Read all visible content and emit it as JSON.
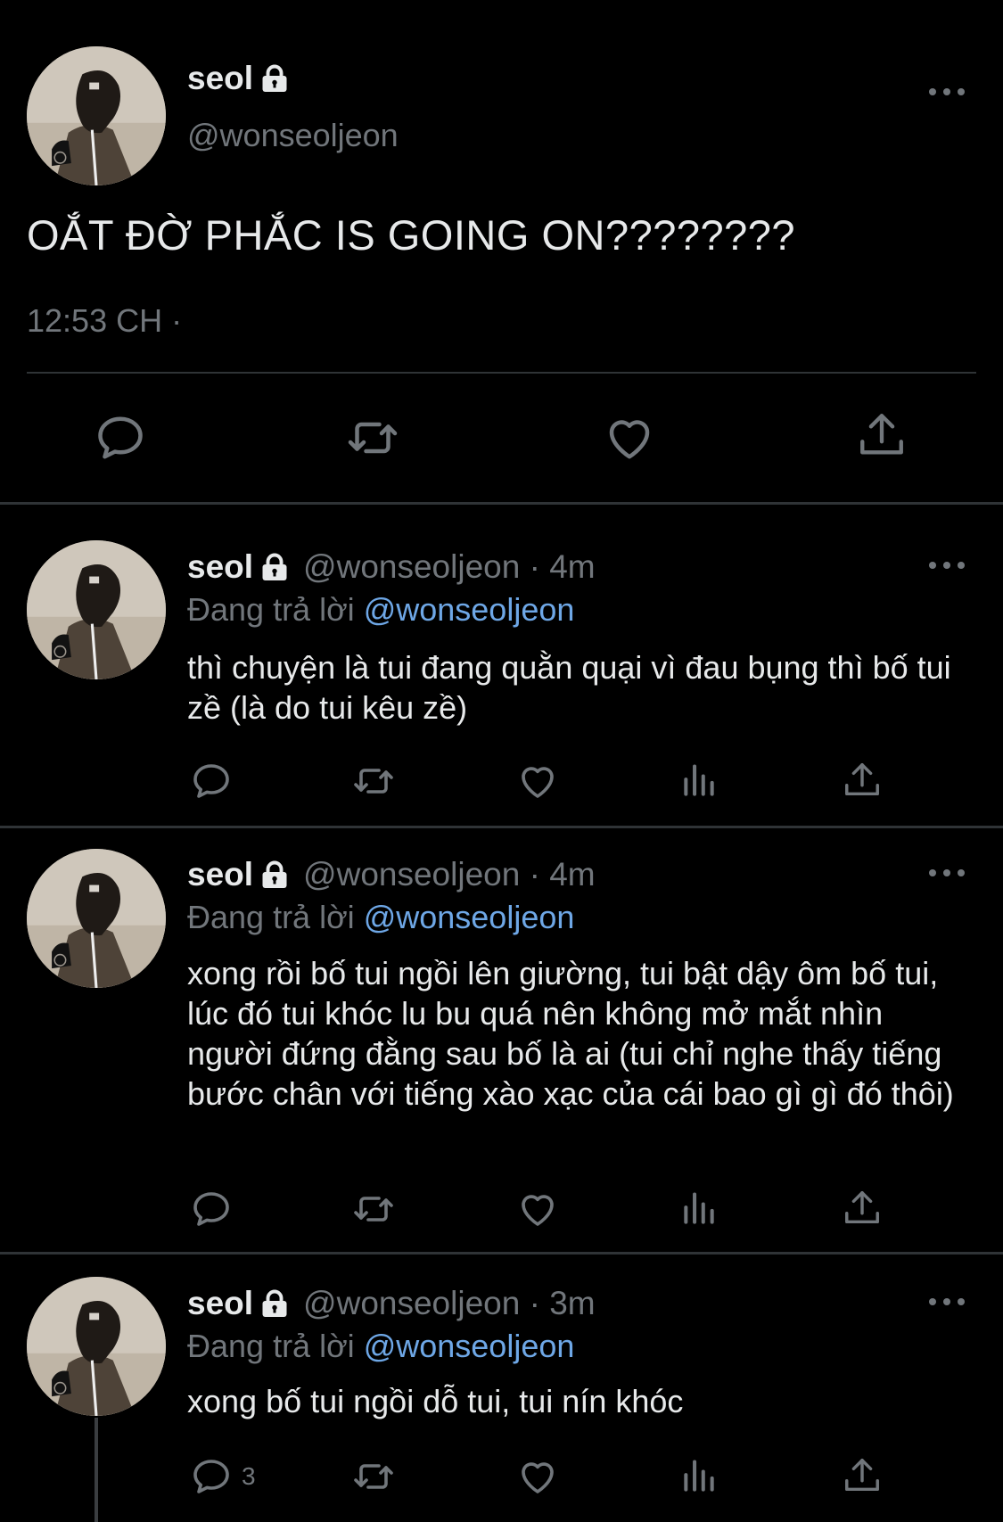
{
  "main": {
    "name": "seol",
    "handle": "@wonseoljeon",
    "text": "OẮT ĐỜ PHẮC IS GOING ON????????",
    "time": "12:53 CH ·"
  },
  "replies": [
    {
      "name": "seol",
      "handle": "@wonseoljeon · 4m",
      "replying_label": "Đang trả lời",
      "replying_to": "@wonseoljeon",
      "text": "thì chuyện là tui đang quằn quại vì đau bụng thì bố tui zề (là do tui kêu zề)"
    },
    {
      "name": "seol",
      "handle": "@wonseoljeon · 4m",
      "replying_label": "Đang trả lời",
      "replying_to": "@wonseoljeon",
      "text": "xong rồi bố tui ngồi lên giường, tui bật dậy ôm bố tui, lúc đó tui khóc lu bu quá nên không mở mắt nhìn người đứng đằng sau bố là ai (tui chỉ nghe thấy tiếng bước chân với tiếng xào xạc của cái bao gì gì đó thôi)"
    },
    {
      "name": "seol",
      "handle": "@wonseoljeon · 3m",
      "replying_label": "Đang trả lời",
      "replying_to": "@wonseoljeon",
      "text": "xong bố tui ngồi dỗ tui, tui nín khóc",
      "reply_count": "3"
    }
  ],
  "icons": [
    "reply-icon",
    "retweet-icon",
    "like-icon",
    "views-icon",
    "share-icon",
    "lock-icon",
    "more-icon"
  ],
  "colors": {
    "background": "#000000",
    "text": "#e7e9ea",
    "muted": "#71767b",
    "mention": "#6ea7e6",
    "divider": "#2f3336"
  }
}
